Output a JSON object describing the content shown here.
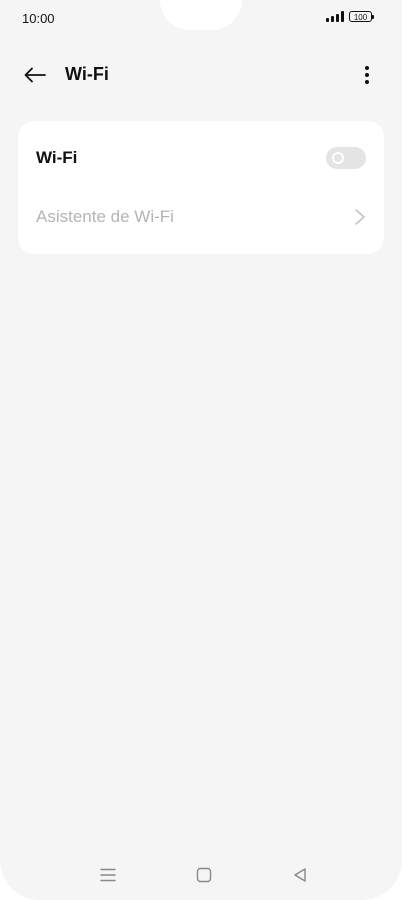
{
  "status_bar": {
    "time": "10:00",
    "battery": "100"
  },
  "header": {
    "title": "Wi-Fi",
    "back_icon": "arrow-left-icon",
    "more_icon": "more-vertical-icon"
  },
  "settings": {
    "wifi_label": "Wi-Fi",
    "wifi_enabled": false,
    "assistant_label": "Asistente de Wi-Fi"
  },
  "nav_bar": {
    "menu_icon": "menu-icon",
    "home_icon": "home-icon",
    "back_icon": "back-triangle-icon"
  },
  "colors": {
    "background": "#f5f5f5",
    "card": "#ffffff",
    "toggle_off": "#e4e4e4",
    "disabled_text": "#b4b4b4"
  }
}
